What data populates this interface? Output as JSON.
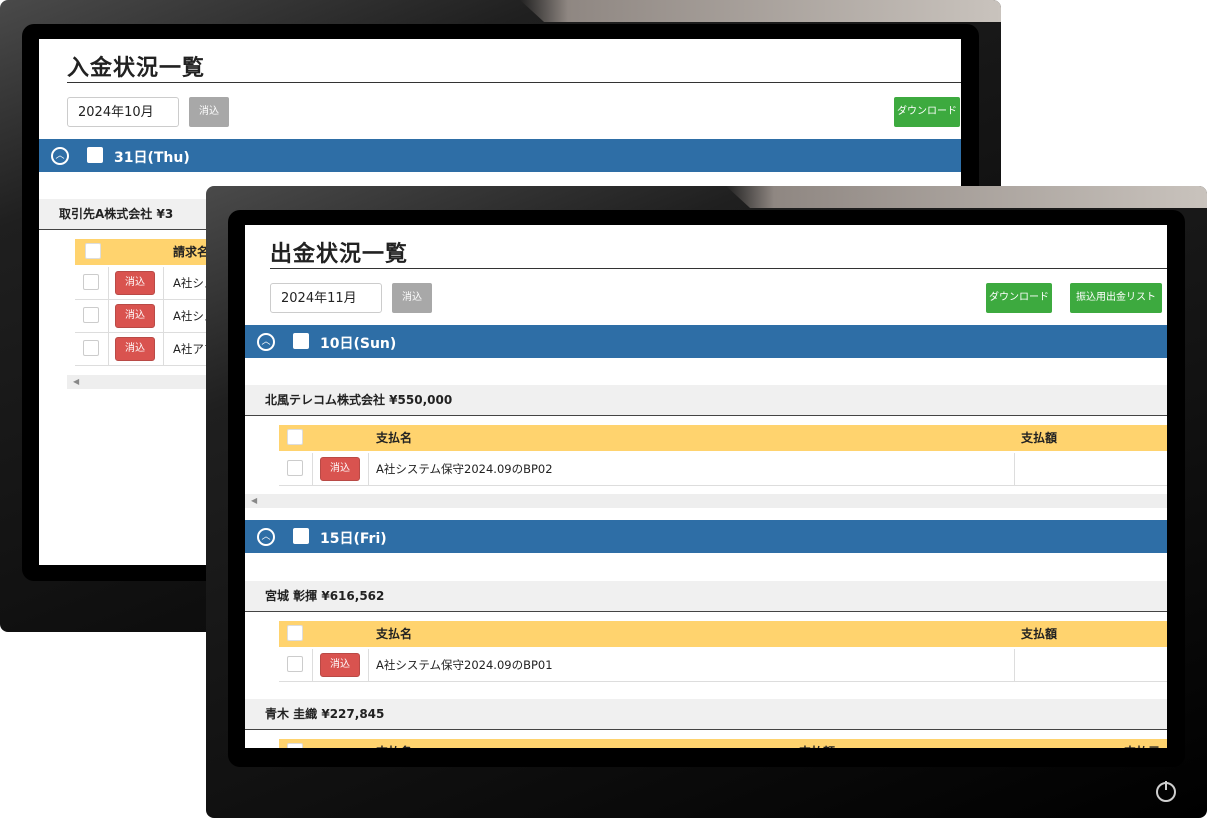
{
  "back_app": {
    "title": "入金状況一覧",
    "month": "2024年10月",
    "clear_label": "消込",
    "download_label": "ダウンロード",
    "day_label": "31日(Thu)",
    "payer": "取引先A株式会社 ¥3",
    "table_header_name": "請求名",
    "rows": [
      {
        "action": "消込",
        "name": "A社シス"
      },
      {
        "action": "消込",
        "name": "A社シス"
      },
      {
        "action": "消込",
        "name": "A社アプ"
      }
    ]
  },
  "front_app": {
    "title": "出金状況一覧",
    "month": "2024年11月",
    "clear_label": "消込",
    "download_label": "ダウンロード",
    "transfer_list_label": "振込用出金リスト",
    "groups": [
      {
        "day_label": "10日(Sun)",
        "payees": [
          {
            "label": "北風テレコム株式会社 ¥550,000",
            "col_name": "支払名",
            "col_amount": "支払額",
            "rows": [
              {
                "action": "消込",
                "name": "A社システム保守2024.09のBP02"
              }
            ]
          }
        ]
      },
      {
        "day_label": "15日(Fri)",
        "payees": [
          {
            "label": "宮城 彰揮 ¥616,562",
            "col_name": "支払名",
            "col_amount": "支払額",
            "rows": [
              {
                "action": "消込",
                "name": "A社システム保守2024.09のBP01"
              }
            ]
          },
          {
            "label": "青木 圭織 ¥227,845"
          }
        ]
      }
    ],
    "partial_header": {
      "col_name": "支払名",
      "col_amount": "支払額",
      "col_extra": "支払元"
    }
  },
  "icons": {
    "collapse": "chevron-up-circle-icon",
    "scroll_left": "scroll-left-arrow-icon",
    "power": "power-icon"
  },
  "colors": {
    "day_band": "#2e6ea6",
    "table_header": "#ffd36e",
    "clear_button": "#d9534f",
    "download_button": "#3daa3f",
    "month_clear_button": "#a8a8a8"
  }
}
